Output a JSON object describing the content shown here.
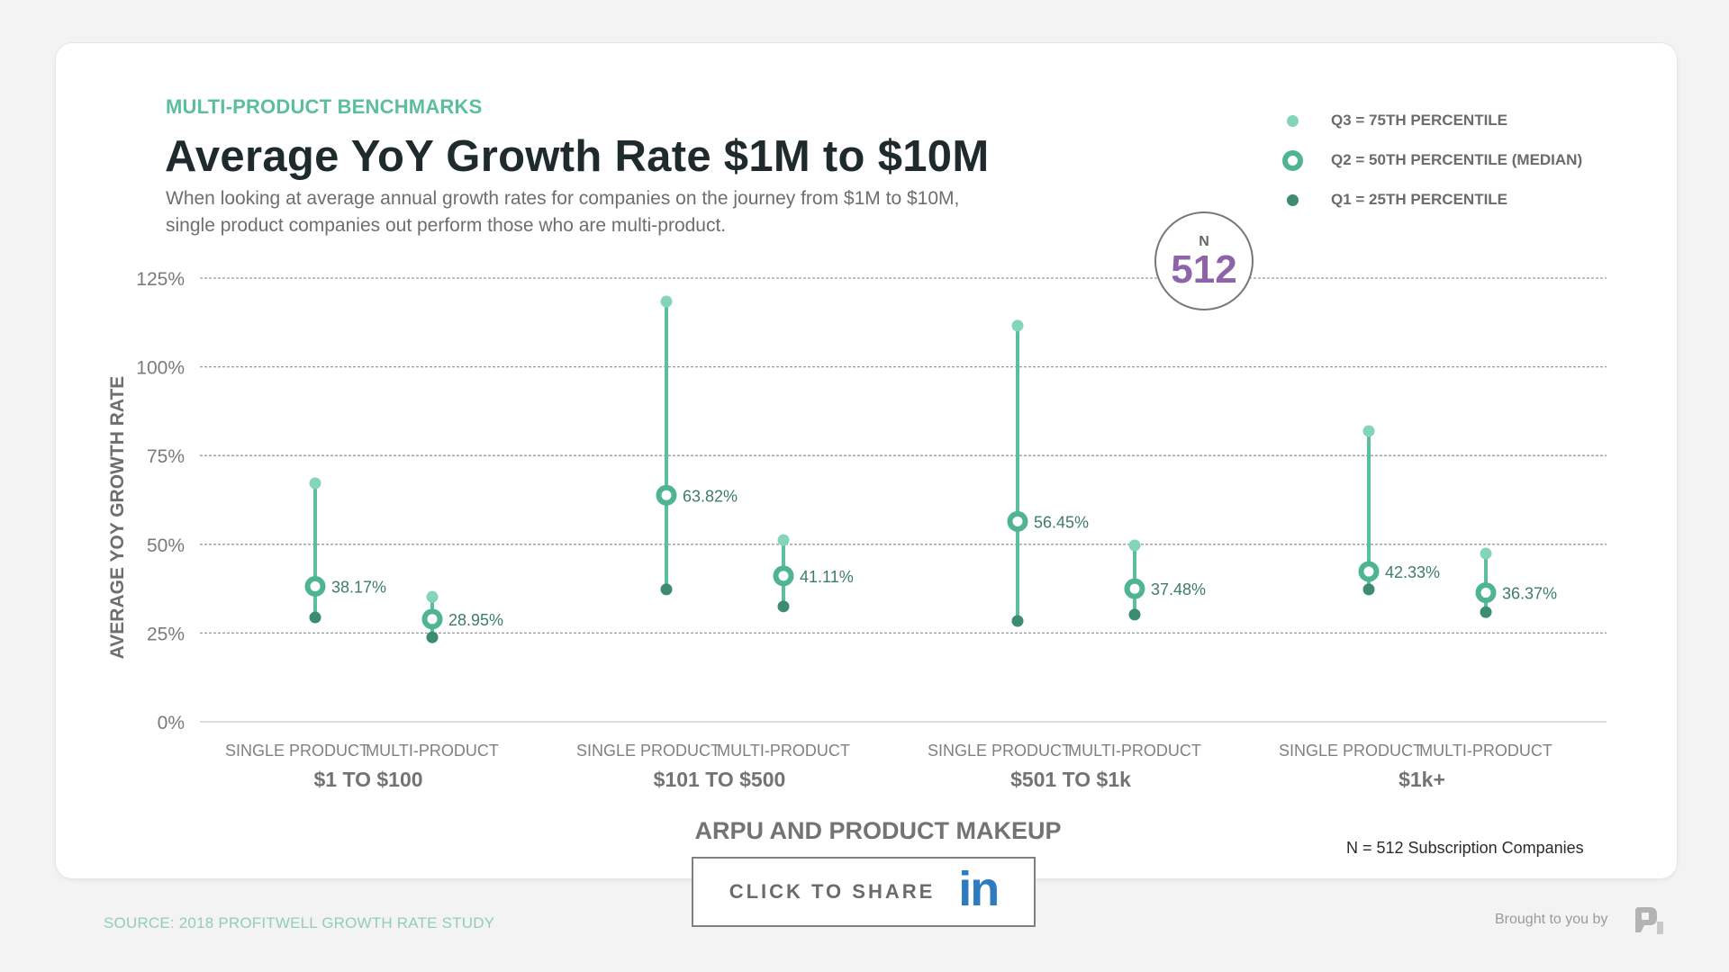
{
  "header": {
    "eyebrow": "MULTI-PRODUCT BENCHMARKS",
    "title": "Average YoY Growth Rate $1M to $10M",
    "subtitle_line1": "When looking at average annual growth rates for companies on the journey from $1M to $10M,",
    "subtitle_line2": "single product companies out perform those who are multi-product."
  },
  "legend": {
    "items": [
      {
        "key": "q3",
        "label": "Q3 = 75TH PERCENTILE",
        "icon": "light-dot-icon"
      },
      {
        "key": "q2",
        "label": "Q2 = 50TH PERCENTILE (MEDIAN)",
        "icon": "ring-icon"
      },
      {
        "key": "q1",
        "label": "Q1 = 25TH PERCENTILE",
        "icon": "dark-dot-icon"
      }
    ]
  },
  "n_badge": {
    "label": "N",
    "value": "512"
  },
  "colors": {
    "accent": "#5cbf9c",
    "q3": "#84d4b8",
    "q2": "#4fb492",
    "q1": "#3d8b72",
    "line": "#5cbf9c",
    "n_value": "#8e64a8",
    "linkedin": "#2f7bbf",
    "grid": "#9a9a9a",
    "value_label": "#3d7d68"
  },
  "chart_data": {
    "type": "range-dot",
    "title": "Average YoY Growth Rate $1M to $10M",
    "ylabel": "AVERAGE YOY GROWTH RATE",
    "xlabel": "ARPU AND PRODUCT MAKEUP",
    "ylim": [
      0,
      125
    ],
    "yticks": [
      0,
      25,
      50,
      75,
      100,
      125
    ],
    "ytick_labels": [
      "0%",
      "25%",
      "50%",
      "75%",
      "100%",
      "125%"
    ],
    "grid": true,
    "legend_position": "top-right",
    "groups": [
      {
        "label": "$1 TO $100",
        "items": [
          {
            "label": "SINGLE PRODUCT",
            "q1": 29.4,
            "q2": 38.17,
            "q3": 67.2,
            "q2_label": "38.17%"
          },
          {
            "label": "MULTI-PRODUCT",
            "q1": 23.8,
            "q2": 28.95,
            "q3": 35.2,
            "q2_label": "28.95%"
          }
        ]
      },
      {
        "label": "$101 TO $500",
        "items": [
          {
            "label": "SINGLE PRODUCT",
            "q1": 37.3,
            "q2": 63.82,
            "q3": 118.4,
            "q2_label": "63.82%"
          },
          {
            "label": "MULTI-PRODUCT",
            "q1": 32.5,
            "q2": 41.11,
            "q3": 51.2,
            "q2_label": "41.11%"
          }
        ]
      },
      {
        "label": "$501 TO $1k",
        "items": [
          {
            "label": "SINGLE PRODUCT",
            "q1": 28.4,
            "q2": 56.45,
            "q3": 111.6,
            "q2_label": "56.45%"
          },
          {
            "label": "MULTI-PRODUCT",
            "q1": 30.2,
            "q2": 37.48,
            "q3": 49.7,
            "q2_label": "37.48%"
          }
        ]
      },
      {
        "label": "$1k+",
        "items": [
          {
            "label": "SINGLE PRODUCT",
            "q1": 37.3,
            "q2": 42.33,
            "q3": 81.9,
            "q2_label": "42.33%"
          },
          {
            "label": "MULTI-PRODUCT",
            "q1": 30.9,
            "q2": 36.37,
            "q3": 47.4,
            "q2_label": "36.37%"
          }
        ]
      }
    ]
  },
  "footer": {
    "share_label": "CLICK TO SHARE",
    "share_icon": "linkedin-icon",
    "share_icon_text": "in",
    "n_note": "N = 512 Subscription Companies",
    "source": "SOURCE: 2018 PROFITWELL GROWTH RATE STUDY",
    "brought_by": "Brought to you by"
  }
}
